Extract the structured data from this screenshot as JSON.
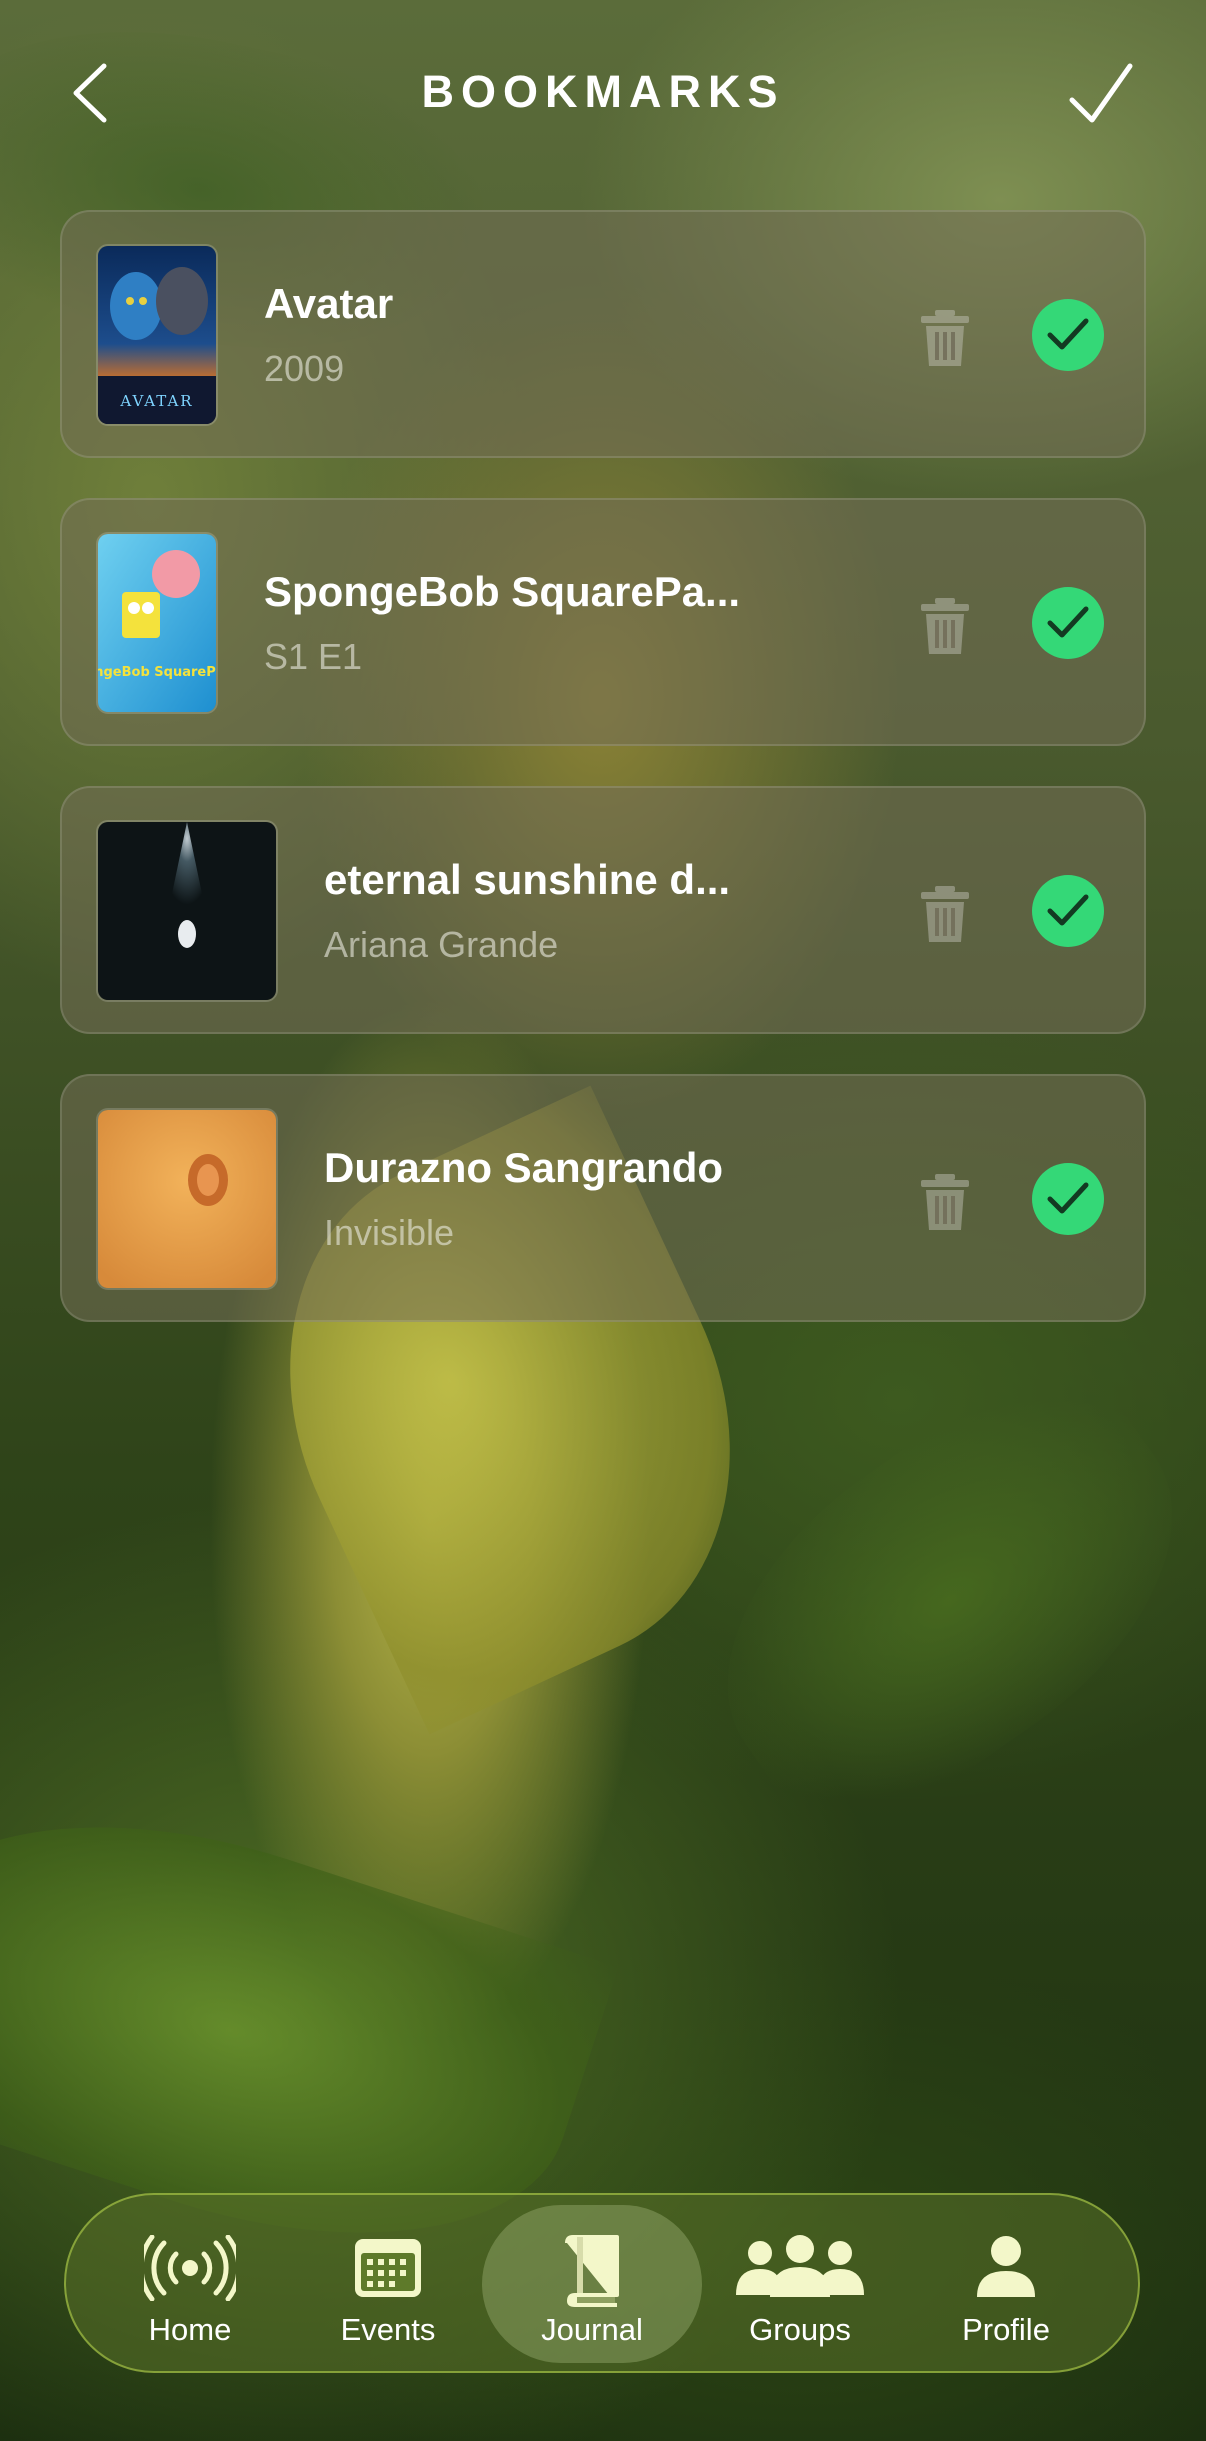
{
  "header": {
    "title": "BOOKMARKS",
    "back_icon": "chevron-left-icon",
    "done_icon": "checkmark-icon"
  },
  "bookmarks": [
    {
      "title": "Avatar",
      "subtitle": "2009",
      "thumb_type": "movie-poster",
      "poster_text": "AVATAR",
      "checked": true
    },
    {
      "title": "SpongeBob SquarePa...",
      "subtitle": "S1 E1",
      "thumb_type": "tv-poster",
      "poster_text": "SpongeBob SquarePants",
      "checked": true
    },
    {
      "title": "eternal sunshine d...",
      "subtitle": "Ariana Grande",
      "thumb_type": "album-cover",
      "checked": true
    },
    {
      "title": "Durazno Sangrando",
      "subtitle": "Invisible",
      "thumb_type": "album-cover",
      "checked": true
    }
  ],
  "nav": {
    "items": [
      {
        "label": "Home",
        "icon": "broadcast-icon"
      },
      {
        "label": "Events",
        "icon": "calendar-icon"
      },
      {
        "label": "Journal",
        "icon": "book-icon",
        "active": true
      },
      {
        "label": "Groups",
        "icon": "group-icon"
      },
      {
        "label": "Profile",
        "icon": "person-icon"
      }
    ]
  },
  "colors": {
    "accent_green": "#34d877",
    "nav_icon": "#f3f7c9",
    "card_bg": "rgba(115,110,85,0.55)"
  }
}
